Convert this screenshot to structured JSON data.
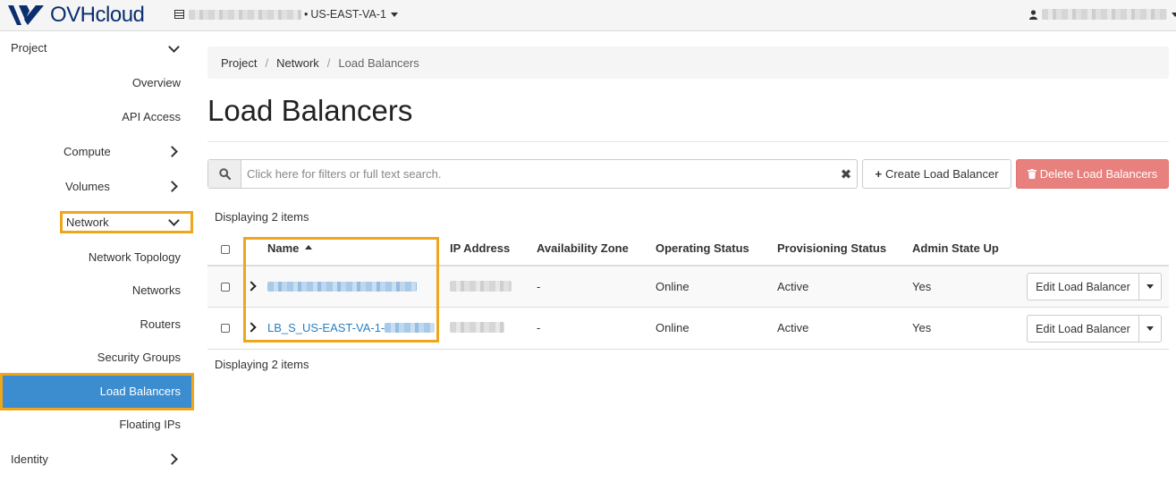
{
  "topbar": {
    "brand": "OVHcloud",
    "region": "US-EAST-VA-1",
    "project_icon": "server-icon",
    "user_icon": "user-icon"
  },
  "sidebar": {
    "project": "Project",
    "overview": "Overview",
    "api_access": "API Access",
    "compute": "Compute",
    "volumes": "Volumes",
    "network": "Network",
    "network_items": [
      "Network Topology",
      "Networks",
      "Routers",
      "Security Groups",
      "Load Balancers",
      "Floating IPs"
    ],
    "identity": "Identity"
  },
  "breadcrumb": [
    "Project",
    "Network",
    "Load Balancers"
  ],
  "page": {
    "title": "Load Balancers",
    "search_placeholder": "Click here for filters or full text search.",
    "create_button": "Create Load Balancer",
    "delete_button": "Delete Load Balancers",
    "count_text": "Displaying 2 items"
  },
  "table": {
    "columns": [
      "Name",
      "IP Address",
      "Availability Zone",
      "Operating Status",
      "Provisioning Status",
      "Admin State Up"
    ],
    "rows": [
      {
        "name": "",
        "ip": "",
        "zone": "-",
        "operating": "Online",
        "provisioning": "Active",
        "admin": "Yes",
        "action": "Edit Load Balancer"
      },
      {
        "name": "LB_S_US-EAST-VA-1-",
        "ip": "",
        "zone": "-",
        "operating": "Online",
        "provisioning": "Active",
        "admin": "Yes",
        "action": "Edit Load Balancer"
      }
    ]
  },
  "colors": {
    "accent": "#3c8dcf",
    "highlight": "#f0a61b",
    "danger": "#e8807d",
    "link": "#2a7fc1"
  }
}
